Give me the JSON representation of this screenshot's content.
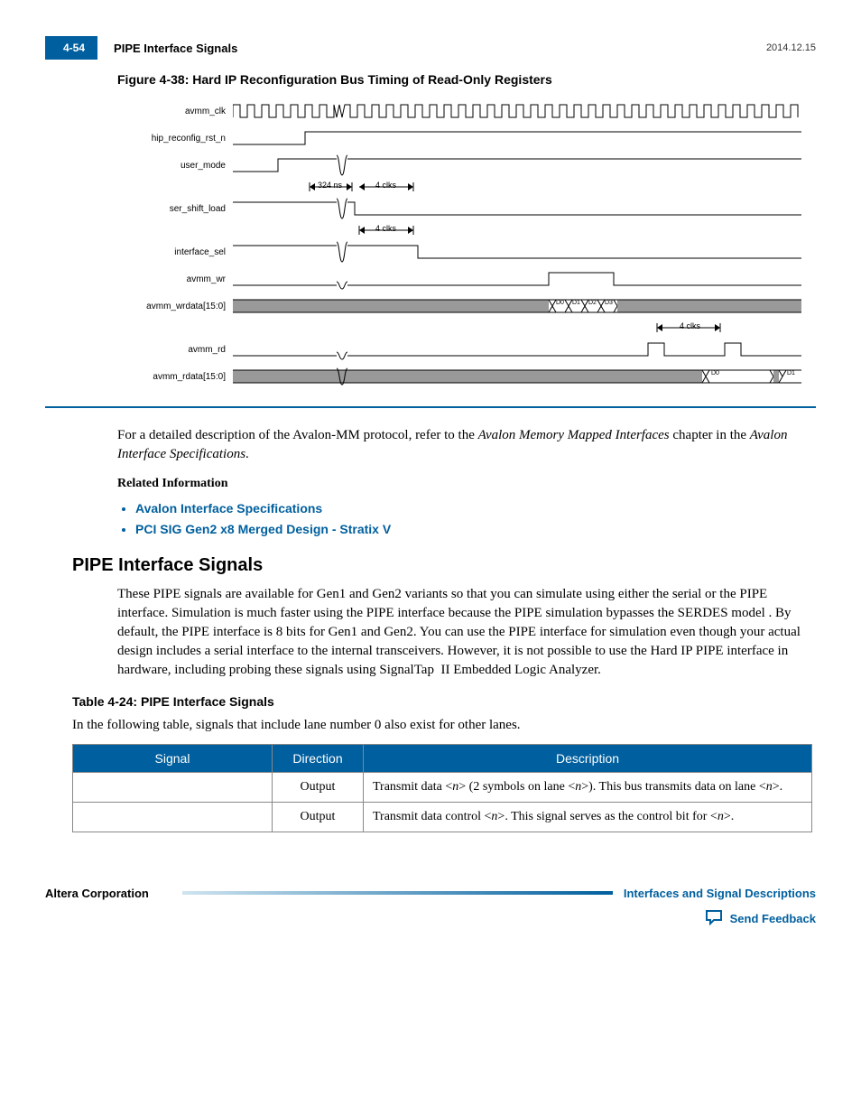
{
  "header": {
    "page_num": "4-54",
    "title": "PIPE Interface Signals",
    "date": "2014.12.15"
  },
  "figure": {
    "caption": "Figure 4-38: Hard IP Reconfiguration Bus Timing of Read-Only Registers",
    "signals": [
      "avmm_clk",
      "hip_reconfig_rst_n",
      "user_mode",
      "ser_shift_load",
      "interface_sel",
      "avmm_wr",
      "avmm_wrdata[15:0]",
      "avmm_rd",
      "avmm_rdata[15:0]"
    ],
    "annotations": {
      "t1": "324 ns",
      "t2": "4 clks",
      "t3": "4 clks",
      "t4": "4 clks",
      "data_w": [
        "D0",
        "D1",
        "D2",
        "D3"
      ],
      "data_r": [
        "D0",
        "D1"
      ]
    }
  },
  "after_figure": {
    "p1a": "For a detailed description of the Avalon-MM protocol, refer to the ",
    "p1b": "Avalon Memory Mapped Interfaces",
    "p1c": " chapter in the ",
    "p1d": "Avalon Interface Specifications",
    "p1e": ".",
    "related_heading": "Related Information",
    "links": [
      "Avalon Interface Specifications",
      "PCI SIG Gen2 x8 Merged Design - Stratix V"
    ]
  },
  "section": {
    "heading": "PIPE Interface Signals",
    "para": "These PIPE signals are available for Gen1 and Gen2 variants so that you can simulate using either the serial or the PIPE interface. Simulation is much faster using the PIPE interface because the PIPE simulation bypasses the SERDES model . By default, the PIPE interface is 8 bits for Gen1 and Gen2. You can use the PIPE interface for simulation even though your actual design includes a serial interface to the internal transceivers. However, it is not possible to use the Hard IP PIPE interface in hardware, including probing these signals using SignalTap  II Embedded Logic Analyzer."
  },
  "table": {
    "caption": "Table 4-24: PIPE Interface Signals",
    "intro": "In the following table, signals that include lane number 0 also exist for other lanes.",
    "headers": [
      "Signal",
      "Direction",
      "Description"
    ],
    "rows": [
      {
        "signal": "",
        "direction": "Output",
        "desc_pre": "Transmit data <",
        "desc_n1": "n",
        "desc_mid": "> (2 symbols on lane <",
        "desc_n2": "n",
        "desc_mid2": ">). This bus transmits data on lane <",
        "desc_n3": "n",
        "desc_end": ">."
      },
      {
        "signal": "",
        "direction": "Output",
        "desc2_pre": "Transmit data control <",
        "desc2_n1": "n",
        "desc2_mid": ">. This signal serves as the control bit for        <",
        "desc2_n2": "n",
        "desc2_end": ">."
      }
    ]
  },
  "footer": {
    "left": "Altera Corporation",
    "right": "Interfaces and Signal Descriptions",
    "feedback": "Send Feedback"
  }
}
